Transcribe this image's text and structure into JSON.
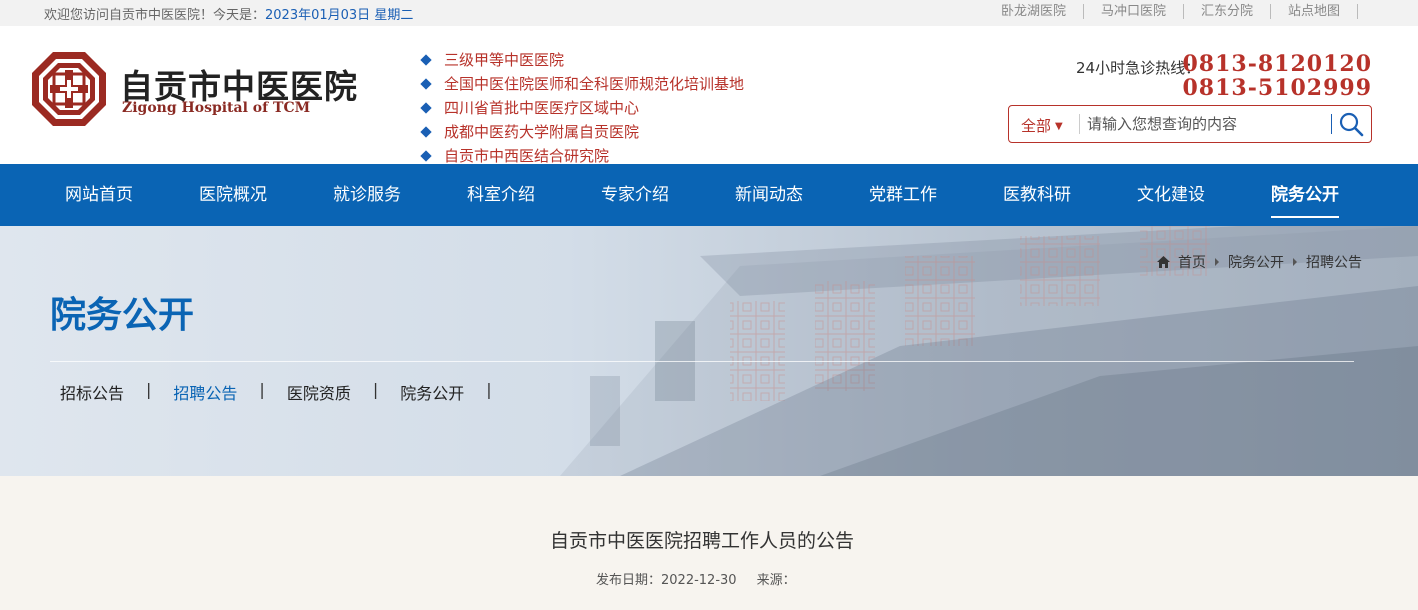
{
  "topbar": {
    "welcome": "欢迎您访问自贡市中医医院！今天是：",
    "date": "2023年01月03日  星期二",
    "links": [
      "卧龙湖医院",
      "马冲口医院",
      "汇东分院",
      "站点地图"
    ]
  },
  "header": {
    "logo_cn": "自贡市中医医院",
    "logo_en": "Zigong Hospital of TCM",
    "features": [
      "三级甲等中医医院",
      "全国中医住院医师和全科医师规范化培训基地",
      "四川省首批中医医疗区域中心",
      "成都中医药大学附属自贡医院",
      "自贡市中西医结合研究院"
    ],
    "hotline_label": "24小时急诊热线：",
    "hotline_1": "0813-8120120",
    "hotline_2": "0813-5102999",
    "search": {
      "scope": "全部",
      "placeholder": "请输入您想查询的内容"
    }
  },
  "nav": {
    "items": [
      "网站首页",
      "医院概况",
      "就诊服务",
      "科室介绍",
      "专家介绍",
      "新闻动态",
      "党群工作",
      "医教科研",
      "文化建设",
      "院务公开"
    ],
    "active": "院务公开"
  },
  "banner": {
    "title": "院务公开",
    "breadcrumb": [
      "首页",
      "院务公开",
      "招聘公告"
    ],
    "subnav": [
      "招标公告",
      "招聘公告",
      "医院资质",
      "院务公开"
    ],
    "subnav_active": "招聘公告"
  },
  "article": {
    "title": "自贡市中医医院招聘工作人员的公告",
    "date_label": "发布日期：2022-12-30",
    "source_label": "来源："
  },
  "colors": {
    "primary_blue": "#0a64b4",
    "brand_red": "#b7322a",
    "content_bg": "#f7f4ef"
  }
}
